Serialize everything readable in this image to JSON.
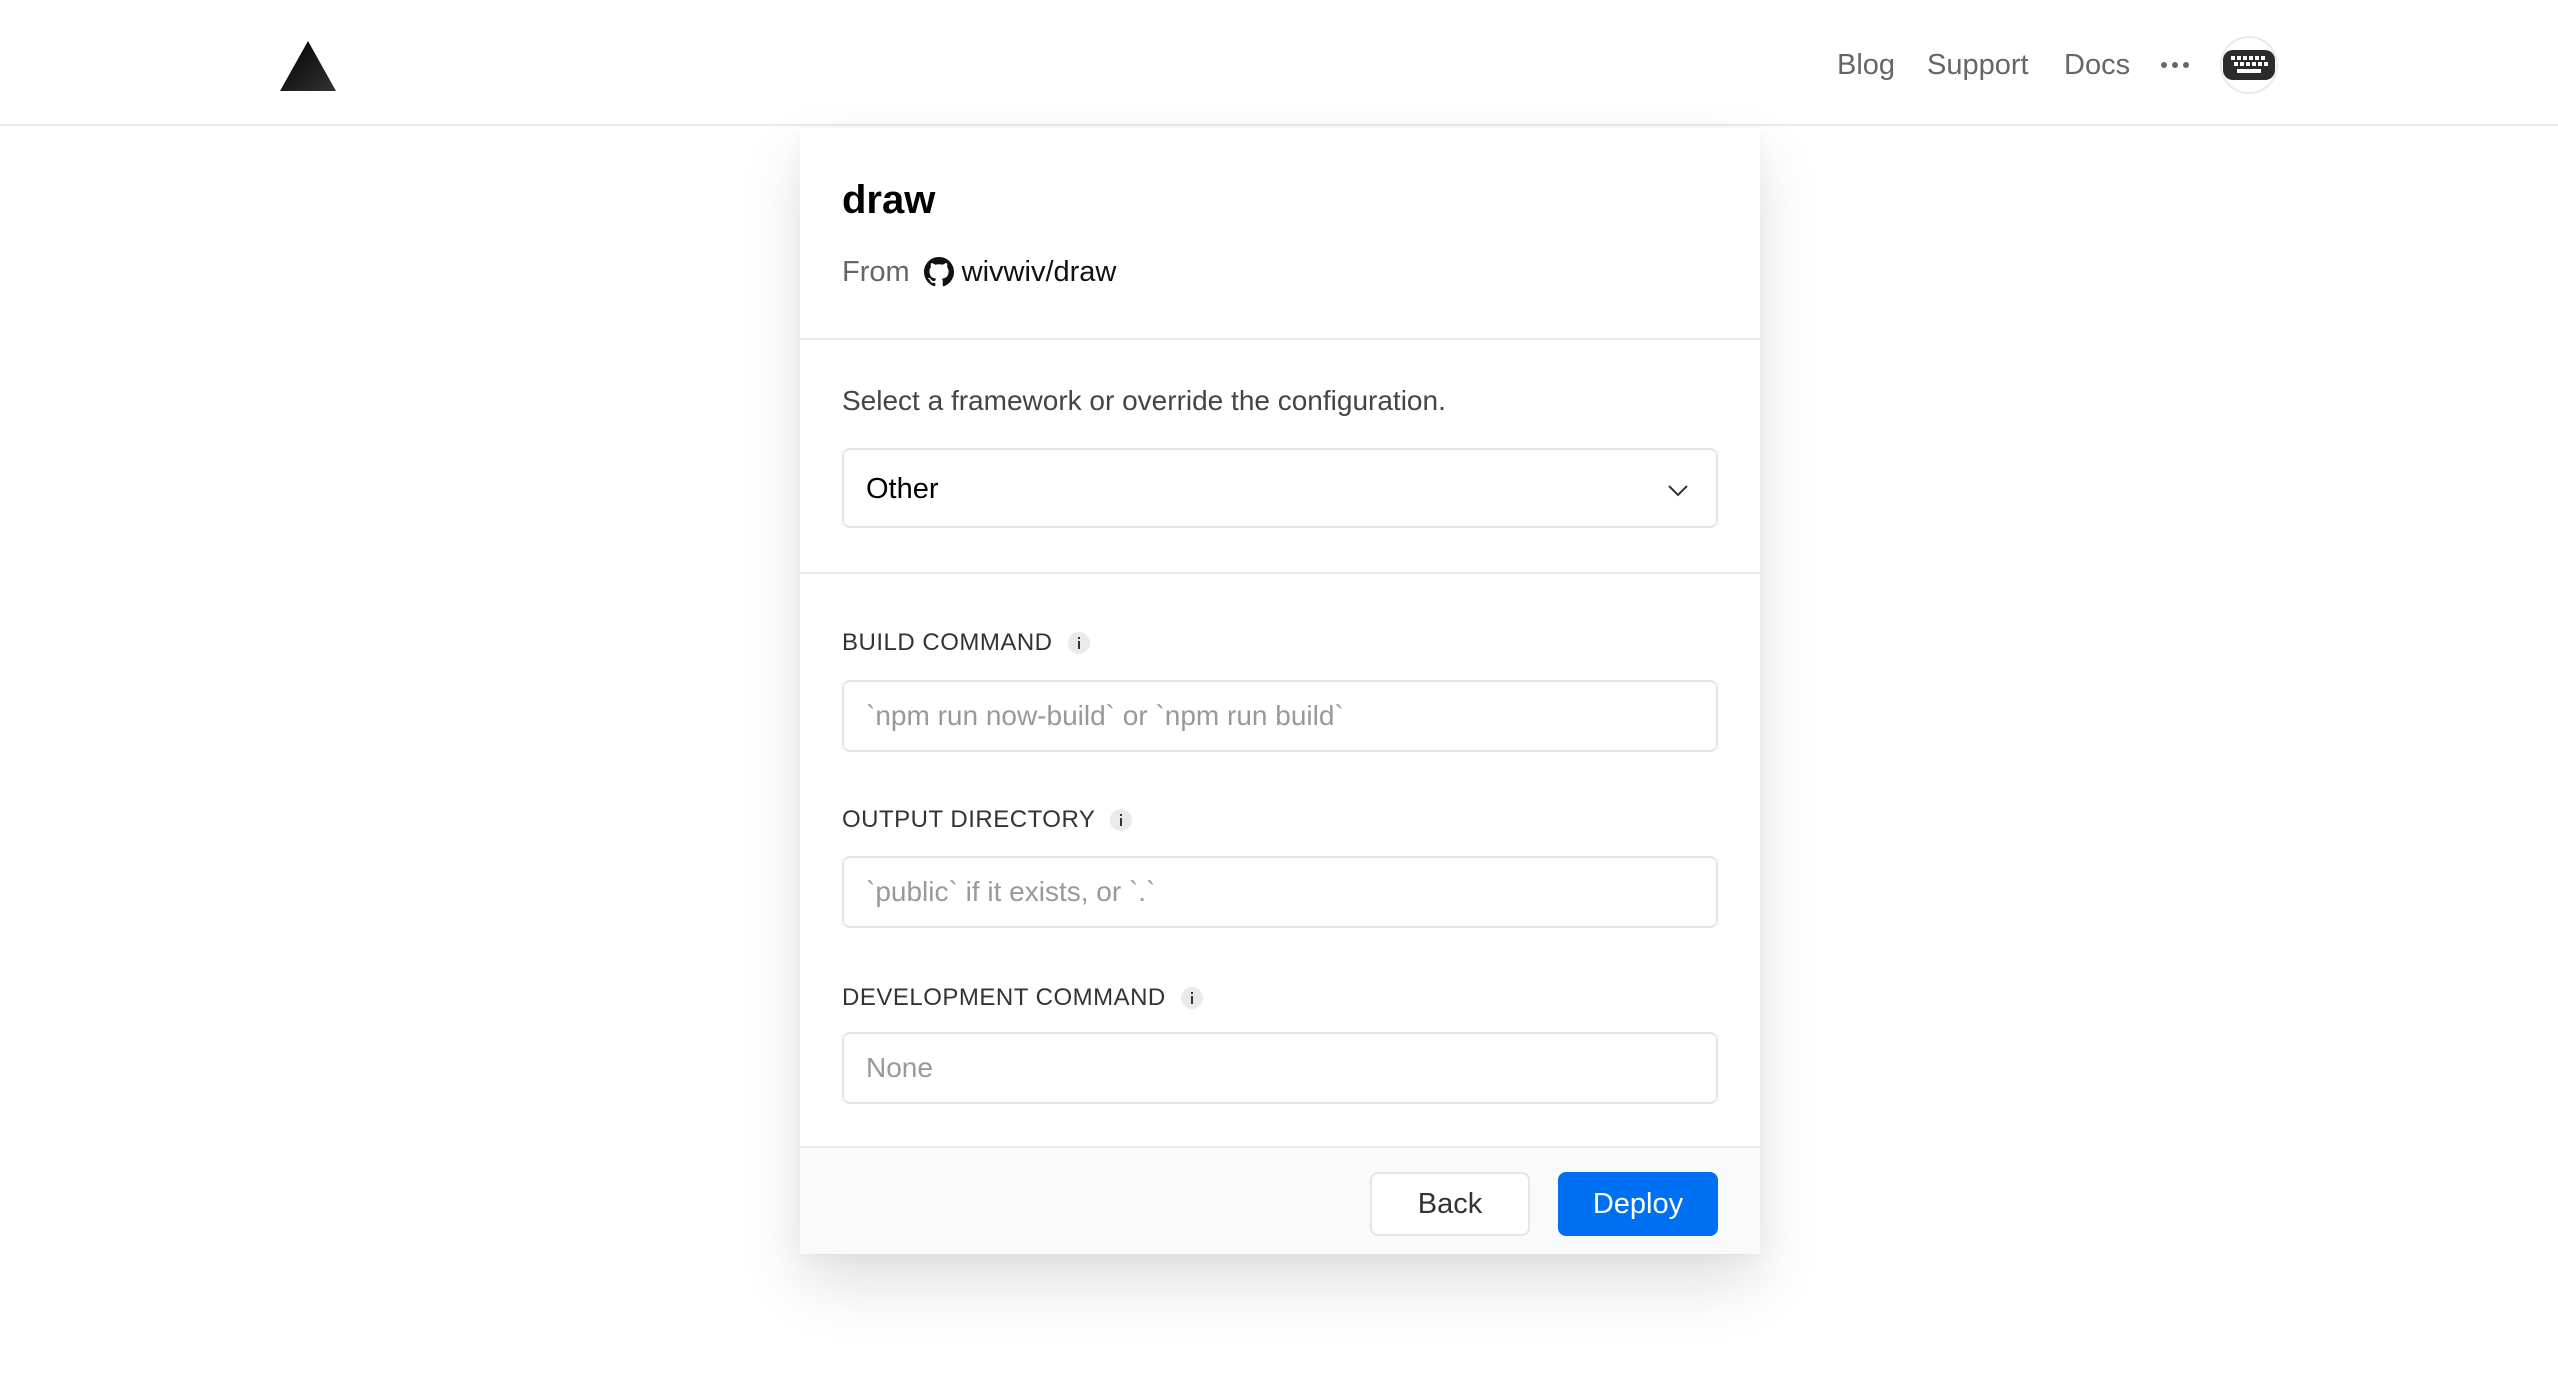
{
  "header": {
    "nav": {
      "blog": "Blog",
      "support": "Support",
      "docs": "Docs",
      "more_icon": "ellipsis-icon"
    },
    "logo_icon": "triangle-logo-icon",
    "avatar_icon": "keyboard-avatar-icon"
  },
  "project": {
    "name": "draw",
    "from_label": "From",
    "repo": "wivwiv/draw",
    "repo_icon": "github-icon"
  },
  "framework": {
    "description": "Select a framework or override the configuration.",
    "selected": "Other"
  },
  "fields": {
    "build": {
      "label": "BUILD COMMAND",
      "placeholder": "`npm run now-build` or `npm run build`",
      "value": ""
    },
    "output": {
      "label": "OUTPUT DIRECTORY",
      "placeholder": "`public` if it exists, or `.`",
      "value": ""
    },
    "dev": {
      "label": "DEVELOPMENT COMMAND",
      "placeholder": "None",
      "value": ""
    }
  },
  "actions": {
    "back": "Back",
    "deploy": "Deploy"
  },
  "colors": {
    "accent": "#0070f3",
    "border": "#eaeaea",
    "muted_text": "#666666"
  }
}
